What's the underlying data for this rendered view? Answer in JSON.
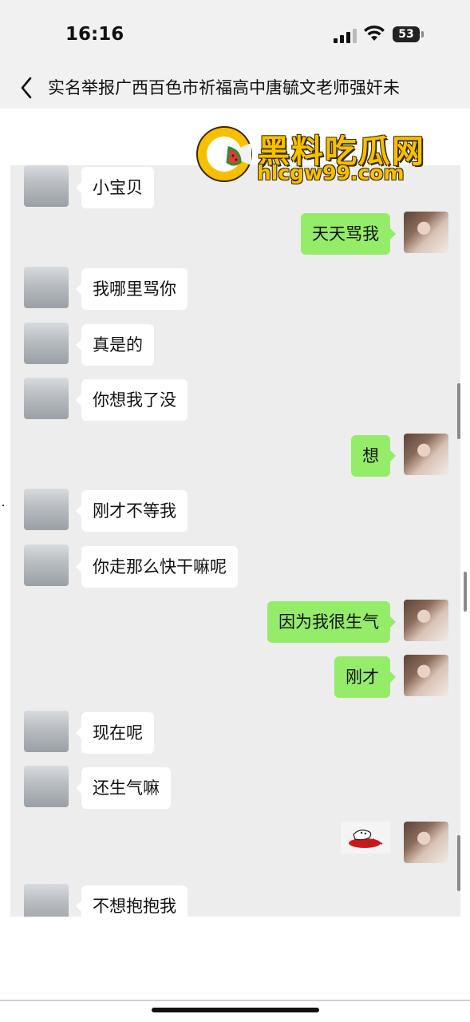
{
  "status_bar": {
    "time": "16:16",
    "battery": "53"
  },
  "nav": {
    "title": "实名举报广西百色市祈福高中唐毓文老师强奸未"
  },
  "watermark": {
    "title": "黑料吃瓜网",
    "url": "hlcgw99.com"
  },
  "messages": [
    {
      "side": "in",
      "text": "小宝贝"
    },
    {
      "side": "out",
      "text": "天天骂我"
    },
    {
      "side": "in",
      "text": "我哪里骂你"
    },
    {
      "side": "in",
      "text": "真是的"
    },
    {
      "side": "in",
      "text": "你想我了没"
    },
    {
      "side": "out",
      "text": "想"
    },
    {
      "side": "in",
      "text": "刚才不等我"
    },
    {
      "side": "in",
      "text": "你走那么快干嘛呢"
    },
    {
      "side": "out",
      "text": "因为我很生气"
    },
    {
      "side": "out",
      "text": "刚才"
    },
    {
      "side": "in",
      "text": "现在呢"
    },
    {
      "side": "in",
      "text": "还生气嘛"
    },
    {
      "side": "out",
      "sticker": "sticker-image"
    },
    {
      "side": "in",
      "text": "不想抱抱我"
    }
  ]
}
